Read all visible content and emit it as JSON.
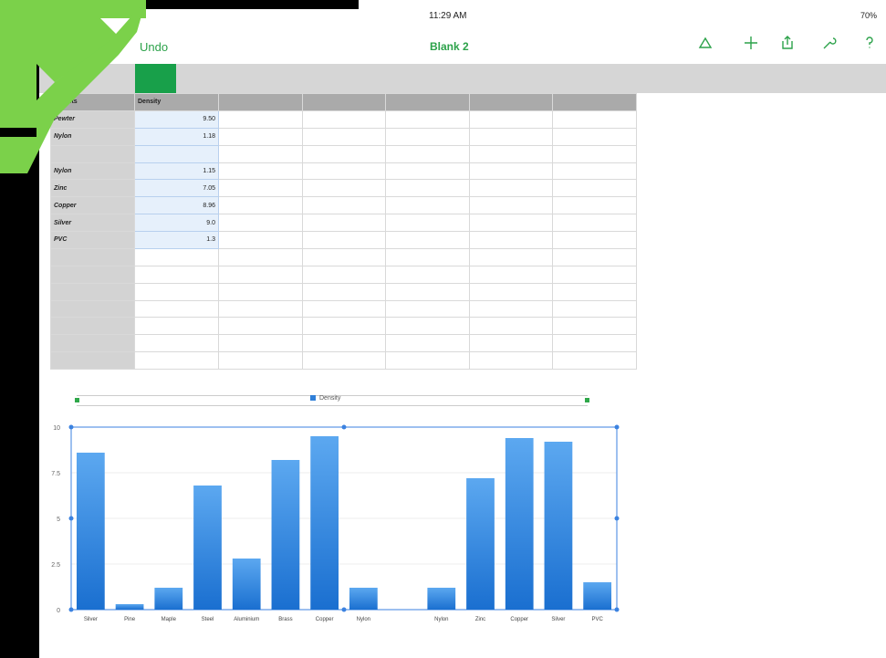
{
  "statusbar": {
    "time": "11:29 AM",
    "battery": "70%"
  },
  "toolbar": {
    "undo_label": "Undo",
    "title": "Blank 2"
  },
  "icons": [
    "brush-icon",
    "add-icon",
    "share-icon",
    "wrench-icon",
    "help-icon"
  ],
  "sheet": {
    "headers": [
      "Objects",
      "Density"
    ],
    "rows": [
      {
        "name": "Pewter",
        "value": "9.50"
      },
      {
        "name": "Nylon",
        "value": "1.18"
      },
      {
        "name": "",
        "value": ""
      },
      {
        "name": "Nylon",
        "value": "1.15"
      },
      {
        "name": "Zinc",
        "value": "7.05"
      },
      {
        "name": "Copper",
        "value": "8.96"
      },
      {
        "name": "Silver",
        "value": "9.0"
      },
      {
        "name": "PVC",
        "value": "1.3"
      }
    ]
  },
  "chart_data": {
    "type": "bar",
    "legend": "Density",
    "categories": [
      "Silver",
      "Pine",
      "Maple",
      "Steel",
      "Aluminium",
      "Brass",
      "Copper",
      "Nylon",
      "",
      "Nylon",
      "Zinc",
      "Copper",
      "Silver",
      "PVC"
    ],
    "values": [
      8.6,
      0.3,
      1.2,
      6.8,
      2.8,
      8.2,
      9.5,
      1.2,
      0,
      1.2,
      7.2,
      9.4,
      9.2,
      1.5
    ],
    "ylim": [
      0,
      10
    ],
    "yticks": [
      "0",
      "2.5",
      "5",
      "7.5",
      "10"
    ],
    "color": "#2f7fd8"
  }
}
